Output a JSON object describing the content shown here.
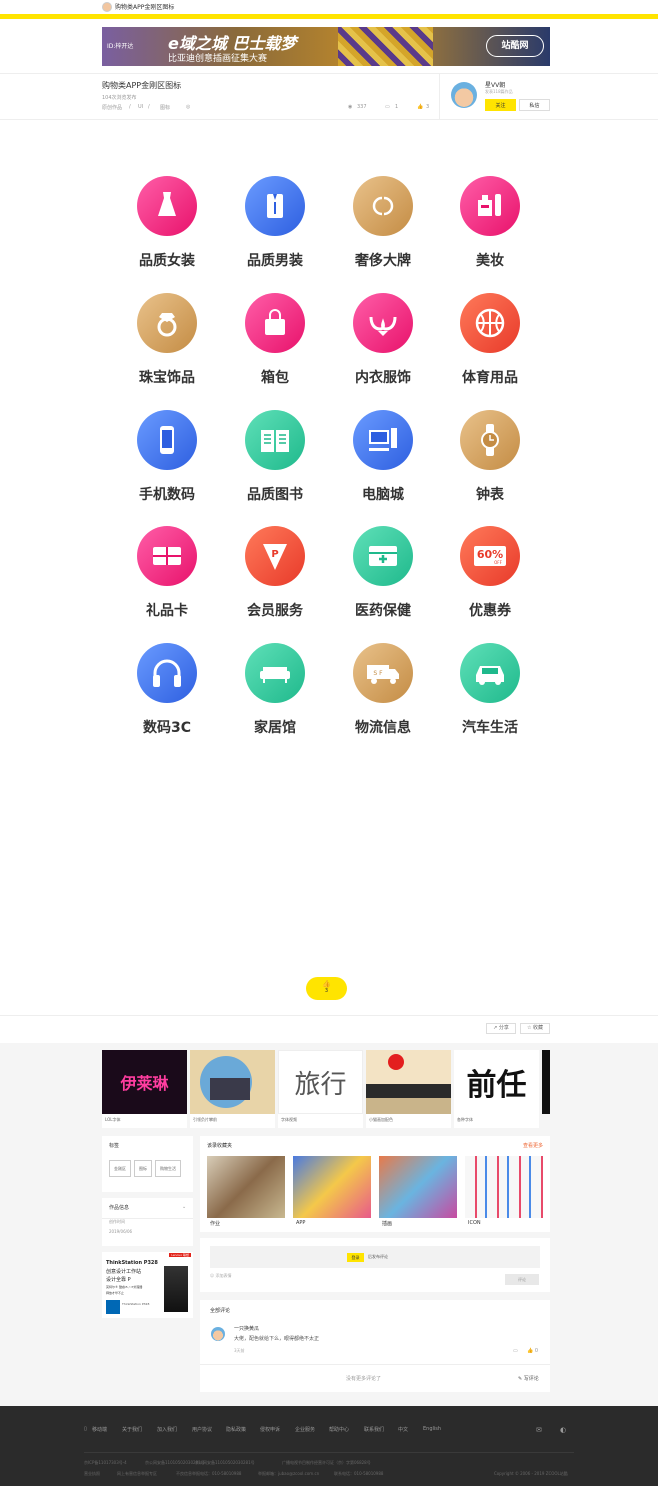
{
  "header": {
    "page_title": "购物类APP金刚区图标"
  },
  "banner": {
    "title": "e域之城 巴士载梦",
    "subtitle": "比亚迪创意插画征集大赛",
    "tag": "ID:梓开达",
    "logo": "站酷网"
  },
  "work": {
    "title": "购物类APP金刚区图标",
    "subtitle": "104次浏览发布",
    "category": "原创作品",
    "sep": "/",
    "sub_category": "UI",
    "type": "图标",
    "views": "337",
    "comments": "1",
    "likes": "3"
  },
  "author": {
    "name": "星VV朝",
    "desc": "发表118篇作品",
    "follow": "关注",
    "message": "私信"
  },
  "icons": [
    {
      "label": "品质女装",
      "color": "pink",
      "icon": "dress-icon"
    },
    {
      "label": "品质男装",
      "color": "blue",
      "icon": "shirt-icon"
    },
    {
      "label": "奢侈大牌",
      "color": "gold",
      "icon": "chanel-icon"
    },
    {
      "label": "美妆",
      "color": "pink",
      "icon": "cosmetics-icon"
    },
    {
      "label": "珠宝饰品",
      "color": "gold",
      "icon": "ring-icon"
    },
    {
      "label": "箱包",
      "color": "pink",
      "icon": "bag-icon"
    },
    {
      "label": "内衣服饰",
      "color": "pink",
      "icon": "bra-icon"
    },
    {
      "label": "体育用品",
      "color": "red",
      "icon": "basketball-icon"
    },
    {
      "label": "手机数码",
      "color": "blue",
      "icon": "phone-icon"
    },
    {
      "label": "品质图书",
      "color": "teal",
      "icon": "book-icon"
    },
    {
      "label": "电脑城",
      "color": "blue",
      "icon": "computer-icon"
    },
    {
      "label": "钟表",
      "color": "gold",
      "icon": "watch-icon"
    },
    {
      "label": "礼品卡",
      "color": "pink",
      "icon": "gift-card-icon"
    },
    {
      "label": "会员服务",
      "color": "red",
      "icon": "diamond-badge-icon"
    },
    {
      "label": "医药保健",
      "color": "teal",
      "icon": "medical-icon"
    },
    {
      "label": "优惠券",
      "color": "red",
      "icon": "coupon-icon"
    },
    {
      "label": "数码3C",
      "color": "blue",
      "icon": "headphone-icon"
    },
    {
      "label": "家居馆",
      "color": "teal",
      "icon": "sofa-icon"
    },
    {
      "label": "物流信息",
      "color": "gold",
      "icon": "truck-icon"
    },
    {
      "label": "汽车生活",
      "color": "teal",
      "icon": "car-icon"
    }
  ],
  "icon_text": {
    "coupon": "60%",
    "coupon_sub": "OFF",
    "truck": "S F",
    "pbadge": "P"
  },
  "like": {
    "count": "3"
  },
  "actions": {
    "share": "分享",
    "collect": "收藏"
  },
  "related": [
    {
      "caption": "LOL字体",
      "bg": "#1a0a1a"
    },
    {
      "caption": "引领负片攀前",
      "bg": "#e8d4a8"
    },
    {
      "caption": "字体视频",
      "bg": "#ffffff"
    },
    {
      "caption": "小猫画加配色",
      "bg": "#f3e3c4"
    },
    {
      "caption": "各种字体",
      "bg": "#ffffff"
    }
  ],
  "related_text": {
    "r1": "伊莱琳",
    "r3": "旅行",
    "r5": "前任"
  },
  "sidebar": {
    "tags_title": "标签",
    "tags": [
      "金刚区",
      "图标",
      "购物生活"
    ],
    "info_title": "作品信息",
    "info_label": "创作时间",
    "info_date": "2019/06/06"
  },
  "ad": {
    "brand": "Lenovo 联想",
    "model": "ThinkStation P328",
    "line1": "创意设计工作站",
    "line2": "设计全靠 P",
    "line3": "英特尔® 酷睿i5 / i7处理器",
    "line4": "释放才华不止",
    "price": "ThinkStation P328"
  },
  "collections": {
    "title": "该录收藏夹",
    "more": "查看更多",
    "items": [
      "作业",
      "APP",
      "插画",
      "ICON"
    ]
  },
  "comment": {
    "login": "登录",
    "post": "后发布评论",
    "emoji": "添加表情",
    "submit": "评论",
    "all": "全部评论",
    "user": "一只换黄瓜",
    "text": "大佬，配色就给下么，眼得都绝不太正",
    "time": "3天前",
    "reply_like": "0",
    "no_more": "没有更多评论了",
    "write": "写评论"
  },
  "footer": {
    "nav": [
      "移动端",
      "关于我们",
      "加入我们",
      "用户协议",
      "隐私政策",
      "侵权申诉",
      "企业服务",
      "帮助中心",
      "联系我们",
      "中文",
      "English"
    ],
    "l1": "京ICP备11017303号-4",
    "l2": "京公网安备11010502030281号",
    "l3": "京公网安备11010502030281号",
    "l4": "广播电视节目制作经营许可证（京）字第06828号",
    "l5": "营业执照",
    "l6": "网上有害信息举报专区",
    "l7": "不良信息举报电话：010-58010988",
    "l8": "举报邮箱：jubao@zcool.com.cn",
    "l9": "联系电话：010-58010988",
    "copyright": "Copyright © 2006 - 2019 ZCOOL站酷"
  }
}
